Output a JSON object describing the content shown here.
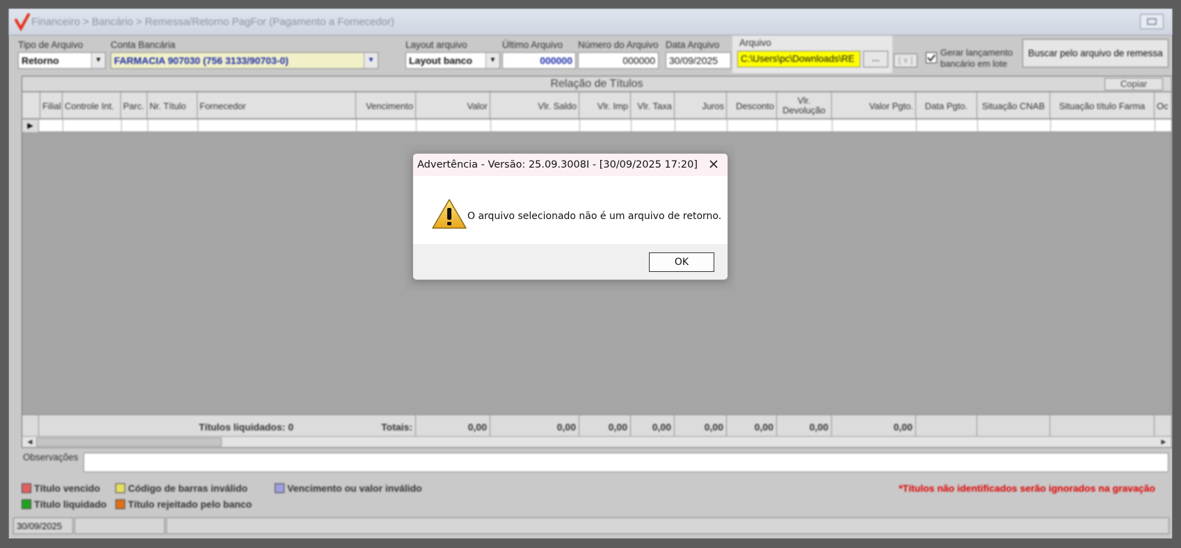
{
  "window": {
    "title": "Financeiro > Bancário > Remessa/Retorno PagFor (Pagamento  a Fornecedor)"
  },
  "filters": {
    "tipo_arquivo": {
      "label": "Tipo de Arquivo",
      "value": "Retorno"
    },
    "conta_bancaria": {
      "label": "Conta Bancária",
      "value": "FARMACIA 907030 (756 3133/90703-0)"
    },
    "layout_arquivo": {
      "label": "Layout arquivo",
      "value": "Layout banco"
    },
    "ultimo_arquivo": {
      "label": "Último Arquivo",
      "value": "000000"
    },
    "numero_arquivo": {
      "label": "Número do Arquivo",
      "value": "000000"
    },
    "data_arquivo": {
      "label": "Data Arquivo",
      "value": "30/09/2025"
    },
    "arquivo": {
      "label": "Arquivo",
      "value": "C:\\Users\\pc\\Downloads\\RE",
      "browse_label": "..."
    },
    "gerar_lancamento": {
      "line1": "Gerar lançamento",
      "line2": "bancário em lote",
      "checked": true
    },
    "buscar_button": "Buscar pelo arquivo de remessa"
  },
  "grid": {
    "title": "Relação de Títulos",
    "copy_label": "Copiar",
    "columns": [
      "Filial",
      "Controle Int.",
      "Parc.",
      "Nr. Título",
      "Fornecedor",
      "Vencimento",
      "Valor",
      "Vlr. Saldo",
      "Vlr. Imp",
      "Vlr. Taxa",
      "Juros",
      "Desconto",
      "Vlr. Devolução",
      "Valor Pgto.",
      "Data Pgto.",
      "Situação CNAB",
      "Situação título Farma",
      "Oc"
    ],
    "titulos_liquidados": "Títulos liquidados: 0",
    "totais_label": "Totais:",
    "totals": [
      "0,00",
      "0,00",
      "0,00",
      "0,00",
      "0,00",
      "0,00",
      "0,00",
      "0,00"
    ]
  },
  "observacoes": {
    "label": "Observações",
    "value": ""
  },
  "legend": {
    "items": [
      {
        "label": "Título vencido",
        "color": "#e06060"
      },
      {
        "label": "Código de barras inválido",
        "color": "#e6e060"
      },
      {
        "label": "Vencimento ou valor inválido",
        "color": "#9e9ee0"
      },
      {
        "label": "Título liquidado",
        "color": "#1fa21f"
      },
      {
        "label": "Título rejeitado pelo banco",
        "color": "#e0701a"
      }
    ],
    "note": "*Títulos não identificados serão ignorados na gravação"
  },
  "statusbar": {
    "date": "30/09/2025"
  },
  "dialog": {
    "title": "Advertência - Versão: 25.09.3008I - [30/09/2025 17:20]",
    "message": "O arquivo selecionado não é um arquivo de retorno.",
    "ok_label": "OK",
    "icon": "warning-icon"
  }
}
